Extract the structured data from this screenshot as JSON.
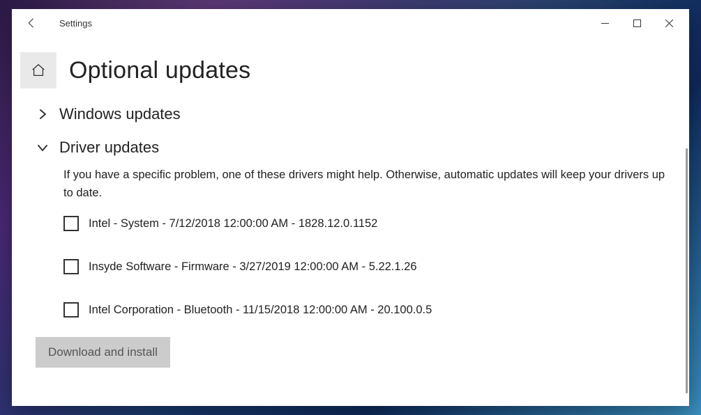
{
  "titlebar": {
    "title": "Settings"
  },
  "header": {
    "page_title": "Optional updates"
  },
  "sections": {
    "windows": {
      "label": "Windows updates"
    },
    "drivers": {
      "label": "Driver updates",
      "description": "If you have a specific problem, one of these drivers might help. Otherwise, automatic updates will keep your drivers up to date.",
      "items": [
        {
          "label": "Intel - System - 7/12/2018 12:00:00 AM - 1828.12.0.1152"
        },
        {
          "label": "Insyde Software - Firmware - 3/27/2019 12:00:00 AM - 5.22.1.26"
        },
        {
          "label": "Intel Corporation - Bluetooth - 11/15/2018 12:00:00 AM - 20.100.0.5"
        }
      ]
    }
  },
  "actions": {
    "download_install": "Download and install"
  }
}
